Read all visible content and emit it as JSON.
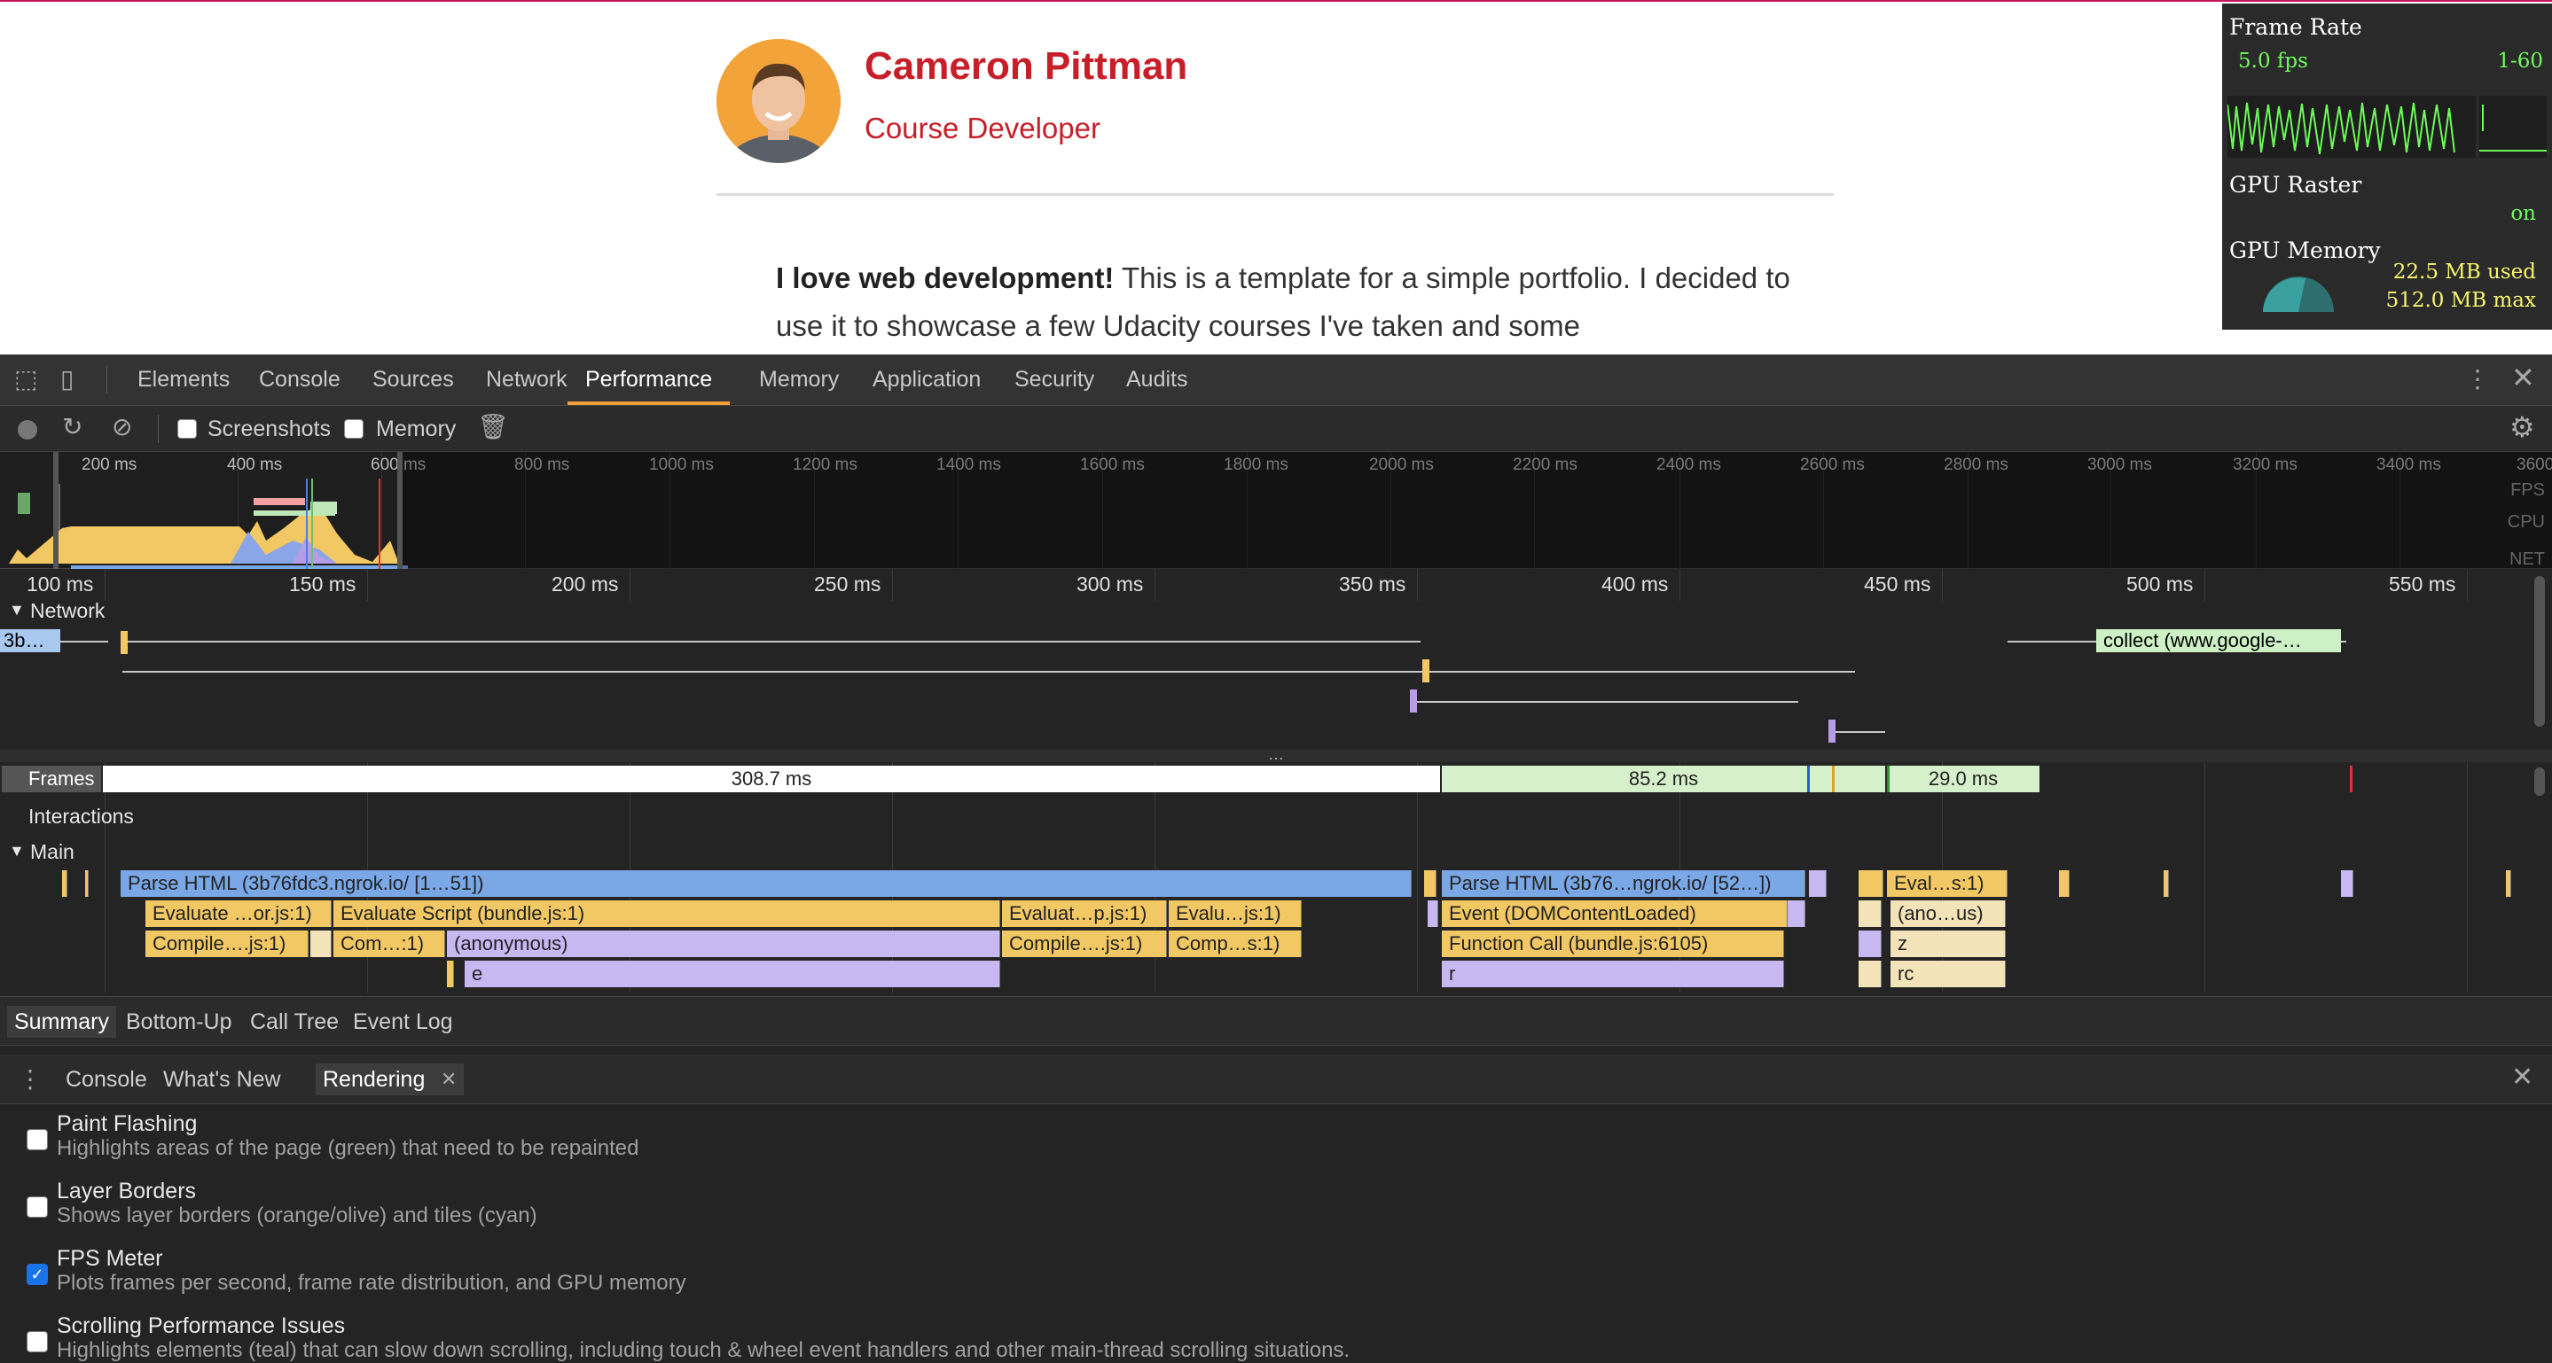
{
  "page": {
    "name": "Cameron Pittman",
    "role": "Course Developer",
    "intro_bold": "I love web development!",
    "intro_text": " This is a template for a simple portfolio. I decided to use it to showcase a few Udacity courses I've taken and some"
  },
  "fps_meter": {
    "frame_rate_label": "Frame Rate",
    "fps_value": "5.0 fps",
    "range": "1-60",
    "gpu_raster_label": "GPU Raster",
    "gpu_raster_value": "on",
    "gpu_memory_label": "GPU Memory",
    "memory_used": "22.5 MB used",
    "memory_max": "512.0 MB max",
    "colors": {
      "graph": "#6dfb5a",
      "memory": "#f7f56e"
    }
  },
  "devtools": {
    "tabs": [
      "Elements",
      "Console",
      "Sources",
      "Network",
      "Performance",
      "Memory",
      "Application",
      "Security",
      "Audits"
    ],
    "active_tab": "Performance",
    "toolbar": {
      "screenshots_label": "Screenshots",
      "memory_label": "Memory"
    },
    "overview": {
      "ticks": [
        "200 ms",
        "400 ms",
        "600 ms",
        "800 ms",
        "1000 ms",
        "1200 ms",
        "1400 ms",
        "1600 ms",
        "1800 ms",
        "2000 ms",
        "2200 ms",
        "2400 ms",
        "2600 ms",
        "2800 ms",
        "3000 ms",
        "3200 ms",
        "3400 ms",
        "3600"
      ],
      "lane_labels": [
        "FPS",
        "CPU",
        "NET"
      ]
    },
    "ruler_ticks": [
      "100 ms",
      "150 ms",
      "200 ms",
      "250 ms",
      "300 ms",
      "350 ms",
      "400 ms",
      "450 ms",
      "500 ms",
      "550 ms"
    ],
    "network": {
      "label": "Network",
      "first_item": "3b…",
      "collect_item": "collect (www.google-…"
    },
    "frames": {
      "label": "Frames",
      "values": [
        "308.7 ms",
        "85.2 ms",
        "29.0 ms"
      ]
    },
    "interactions_label": "Interactions",
    "main_label": "Main",
    "flame": {
      "row1": [
        "Parse HTML (3b76fdc3.ngrok.io/ [1…51])",
        "Parse HTML (3b76…ngrok.io/ [52…])",
        "Eval…s:1)"
      ],
      "row2": [
        "Evaluate …or.js:1)",
        "Evaluate Script (bundle.js:1)",
        "Evaluat…p.js:1)",
        "Evalu…js:1)",
        "Event (DOMContentLoaded)",
        "(ano…us)"
      ],
      "row3": [
        "Compile….js:1)",
        "Com…:1)",
        "(anonymous)",
        "Compile….js:1)",
        "Comp…s:1)",
        "Function Call (bundle.js:6105)",
        "z"
      ],
      "row4": [
        "e",
        "r",
        "rc"
      ]
    },
    "bottom_tabs": [
      "Summary",
      "Bottom-Up",
      "Call Tree",
      "Event Log"
    ],
    "drawer_tabs": [
      "Console",
      "What's New",
      "Rendering"
    ],
    "rendering_options": [
      {
        "title": "Paint Flashing",
        "desc": "Highlights areas of the page (green) that need to be repainted",
        "checked": false
      },
      {
        "title": "Layer Borders",
        "desc": "Shows layer borders (orange/olive) and tiles (cyan)",
        "checked": false
      },
      {
        "title": "FPS Meter",
        "desc": "Plots frames per second, frame rate distribution, and GPU memory",
        "checked": true
      },
      {
        "title": "Scrolling Performance Issues",
        "desc": "Highlights elements (teal) that can slow down scrolling, including touch & wheel event handlers and other main-thread scrolling situations.",
        "checked": false
      }
    ]
  }
}
